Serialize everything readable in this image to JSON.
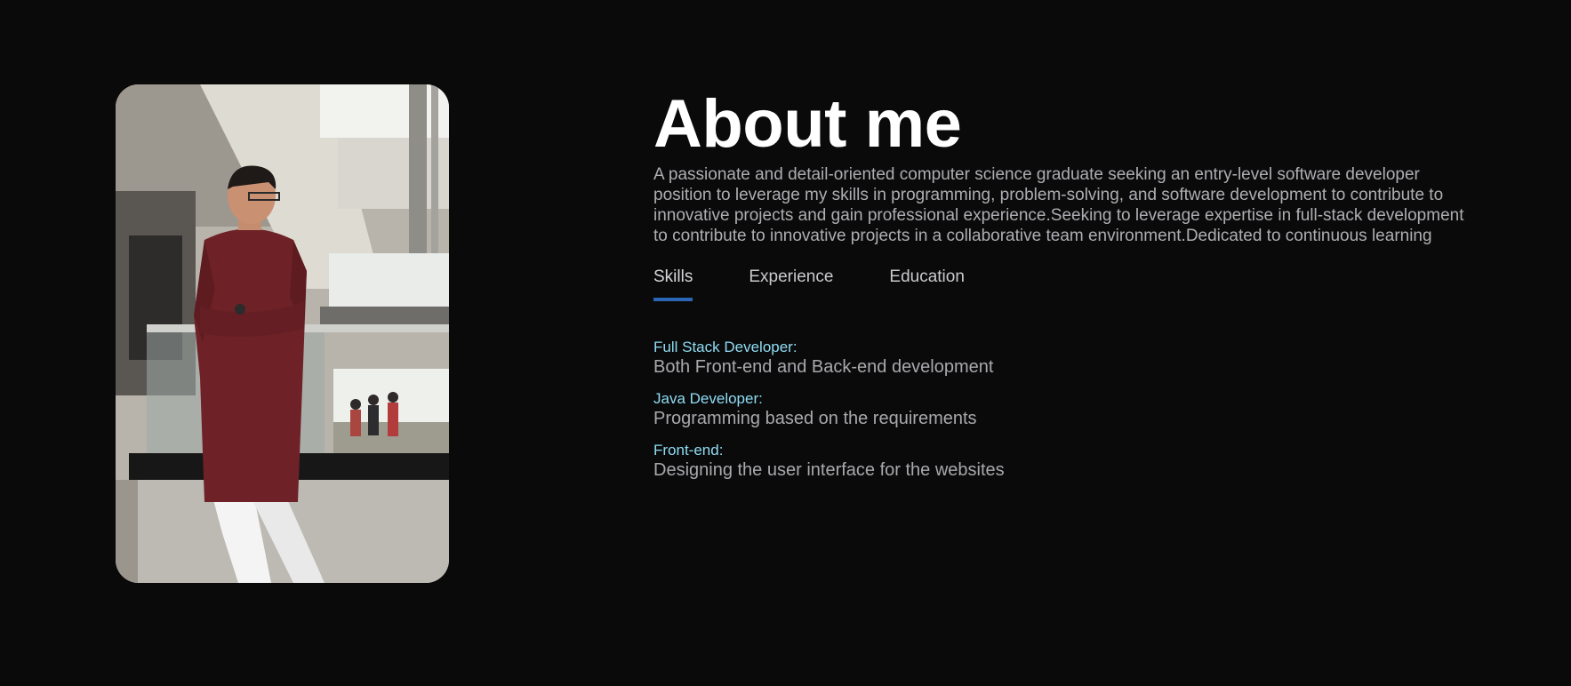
{
  "photo": {
    "subject": "portrait-photo"
  },
  "about": {
    "title": "About me",
    "intro": "A passionate and detail-oriented computer science graduate seeking an entry-level software developer position to leverage my skills in programming, problem-solving, and software development to contribute to innovative projects and gain professional experience.Seeking to leverage expertise in full-stack development to contribute to innovative projects in a collaborative team environment.Dedicated to continuous learning"
  },
  "tabs": [
    {
      "label": "Skills",
      "active": true
    },
    {
      "label": "Experience",
      "active": false
    },
    {
      "label": "Education",
      "active": false
    }
  ],
  "skills": [
    {
      "name": "Full Stack Developer:",
      "desc": "Both Front-end and Back-end development"
    },
    {
      "name": "Java Developer:",
      "desc": "Programming based on the requirements"
    },
    {
      "name": "Front-end:",
      "desc": "Designing the user interface for the websites"
    }
  ],
  "colors": {
    "background": "#0a0a0b",
    "accent": "#2a66b5",
    "skill_name": "#8fdcf2",
    "text_muted": "#aeaeb2"
  }
}
